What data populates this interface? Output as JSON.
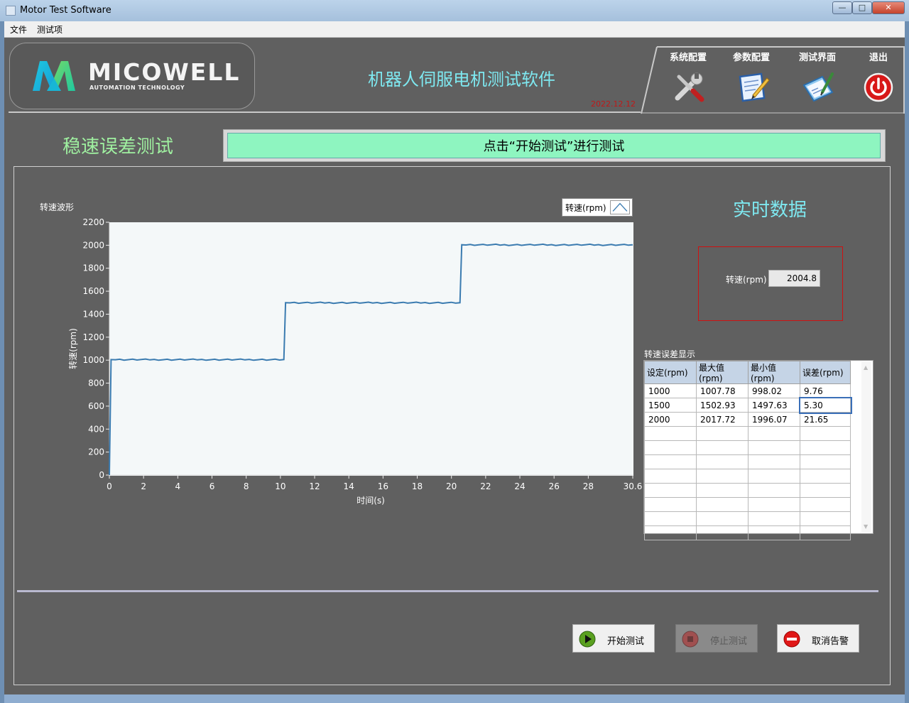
{
  "window": {
    "title": "Motor Test Software",
    "minimize_glyph": "—",
    "maximize_glyph": "□",
    "close_glyph": "✕"
  },
  "menu": [
    "文件",
    "测试项"
  ],
  "header": {
    "brand": "MICOWELL",
    "brand_sub": "AUTOMATION TECHNOLOGY",
    "app_title": "机器人伺服电机测试软件",
    "date": "2022.12.12",
    "nav": [
      {
        "label": "系统配置",
        "icon": "tools-icon"
      },
      {
        "label": "参数配置",
        "icon": "edit-document-icon"
      },
      {
        "label": "测试界面",
        "icon": "clipboard-pen-icon"
      },
      {
        "label": "退出",
        "icon": "power-icon"
      }
    ]
  },
  "test": {
    "name": "稳速误差测试",
    "status": "点击“开始测试”进行测试"
  },
  "chart_data": {
    "type": "line",
    "title": "转速波形",
    "xlabel": "时间(s)",
    "ylabel": "转速(rpm)",
    "xlim": [
      0,
      30.6
    ],
    "ylim": [
      0,
      2200
    ],
    "x_ticks": [
      "0",
      "2",
      "4",
      "6",
      "8",
      "10",
      "12",
      "14",
      "16",
      "18",
      "20",
      "22",
      "24",
      "26",
      "28",
      "30.6"
    ],
    "y_ticks": [
      "0",
      "200",
      "400",
      "600",
      "800",
      "1000",
      "1200",
      "1400",
      "1600",
      "1800",
      "2000",
      "2200"
    ],
    "legend": "top-right",
    "grid": false,
    "series": [
      {
        "name": "转速(rpm)",
        "color": "#3a7bb0",
        "x": [
          0,
          0.1,
          10.2,
          10.3,
          20.5,
          20.6,
          30.6
        ],
        "y": [
          0,
          1005,
          1005,
          1500,
          1500,
          2004,
          2004
        ]
      }
    ]
  },
  "realtime": {
    "title": "实时数据",
    "label": "转速(rpm)",
    "value": "2004.8"
  },
  "error_table": {
    "caption": "转速误差显示",
    "headers": [
      "设定(rpm)",
      "最大值(rpm)",
      "最小值(rpm)",
      "误差(rpm)"
    ],
    "rows": [
      [
        "1000",
        "1007.78",
        "998.02",
        "9.76"
      ],
      [
        "1500",
        "1502.93",
        "1497.63",
        "5.30"
      ],
      [
        "2000",
        "2017.72",
        "1996.07",
        "21.65"
      ]
    ],
    "empty_rows": 8
  },
  "buttons": {
    "start": "开始测试",
    "stop": "停止测试",
    "cancel_alarm": "取消告警"
  },
  "colors": {
    "accent_cyan": "#7ee8f0",
    "status_green": "#8ef5c0",
    "test_name_green": "#9ff0a0",
    "date_red": "#c01818",
    "background": "#606060"
  }
}
